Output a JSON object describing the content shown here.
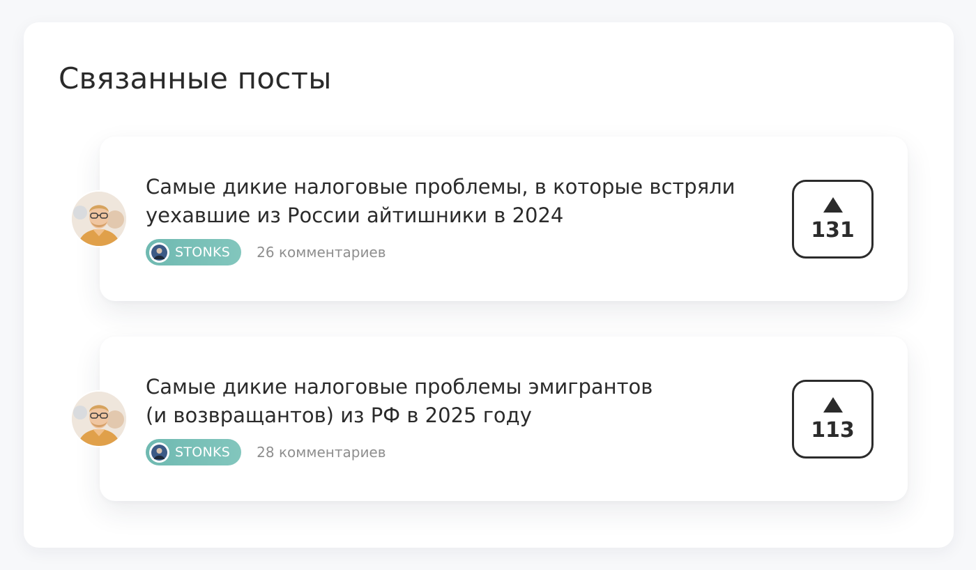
{
  "section": {
    "title": "Связанные посты"
  },
  "posts": [
    {
      "title_line1": "Самые дикие налоговые проблемы, в которые встряли",
      "title_line2": "уехавшие из России айтишники в 2024",
      "tag": "STONKS",
      "comments": "26 комментариев",
      "votes": "131"
    },
    {
      "title_line1": "Самые дикие налоговые проблемы эмигрантов",
      "title_line2": "(и возвращантов) из РФ в 2025 году",
      "tag": "STONKS",
      "comments": "28 комментариев",
      "votes": "113"
    }
  ],
  "icons": {
    "avatar": "author-avatar-icon",
    "tag": "stonks-tag-icon",
    "vote": "upvote-arrow-icon"
  },
  "colors": {
    "tag_background": "#76bdb5",
    "text_primary": "#2b2b2b",
    "text_muted": "#8e8e8e"
  }
}
